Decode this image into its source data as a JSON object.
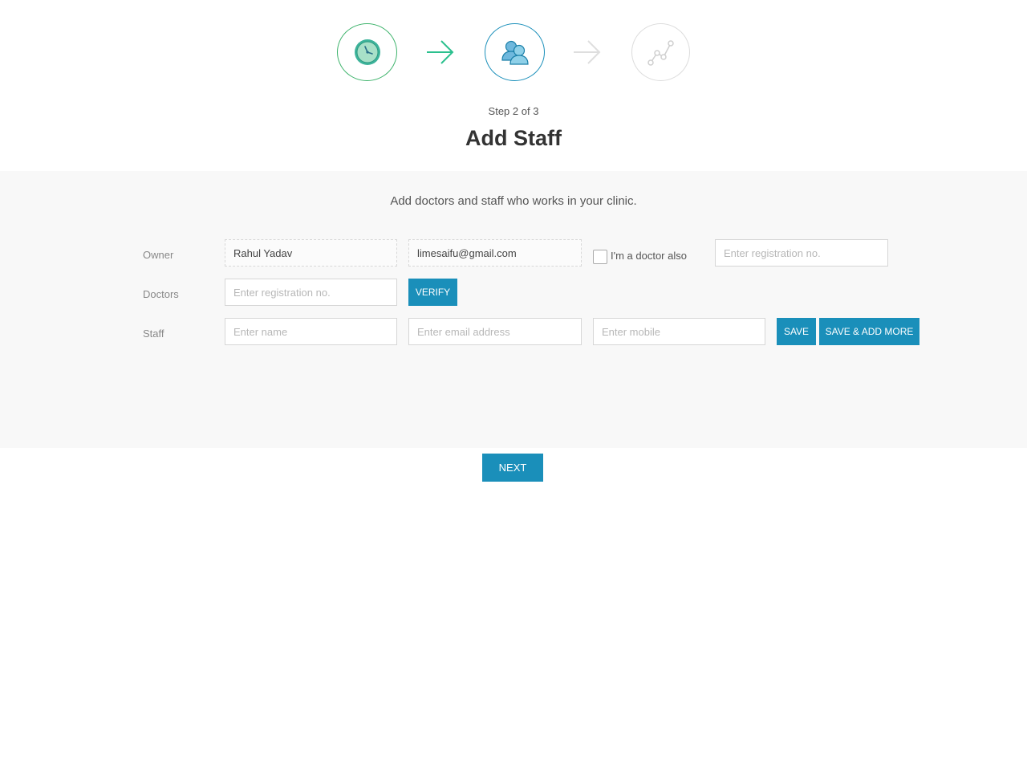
{
  "stepper": {
    "steps": [
      {
        "icon": "clock-icon",
        "state": "done"
      },
      {
        "icon": "users-icon",
        "state": "active"
      },
      {
        "icon": "analytics-icon",
        "state": "todo"
      }
    ],
    "step_count": "Step 2 of 3"
  },
  "page_title": "Add Staff",
  "panel": {
    "subtitle": "Add doctors and staff who works in your clinic.",
    "owner": {
      "label": "Owner",
      "name_value": "Rahul Yadav",
      "email_value": "limesaifu@gmail.com",
      "doctor_checkbox_label": "I'm a doctor also",
      "registration_placeholder": "Enter registration no."
    },
    "doctors": {
      "label": "Doctors",
      "registration_placeholder": "Enter registration no.",
      "verify_label": "VERIFY"
    },
    "staff": {
      "label": "Staff",
      "name_placeholder": "Enter name",
      "email_placeholder": "Enter email address",
      "mobile_placeholder": "Enter mobile",
      "save_label": "SAVE",
      "save_add_more_label": "SAVE & ADD MORE"
    }
  },
  "next_label": "NEXT",
  "colors": {
    "primary": "#1a8fba",
    "success": "#3db36b",
    "panel_bg": "#f8f8f8"
  }
}
